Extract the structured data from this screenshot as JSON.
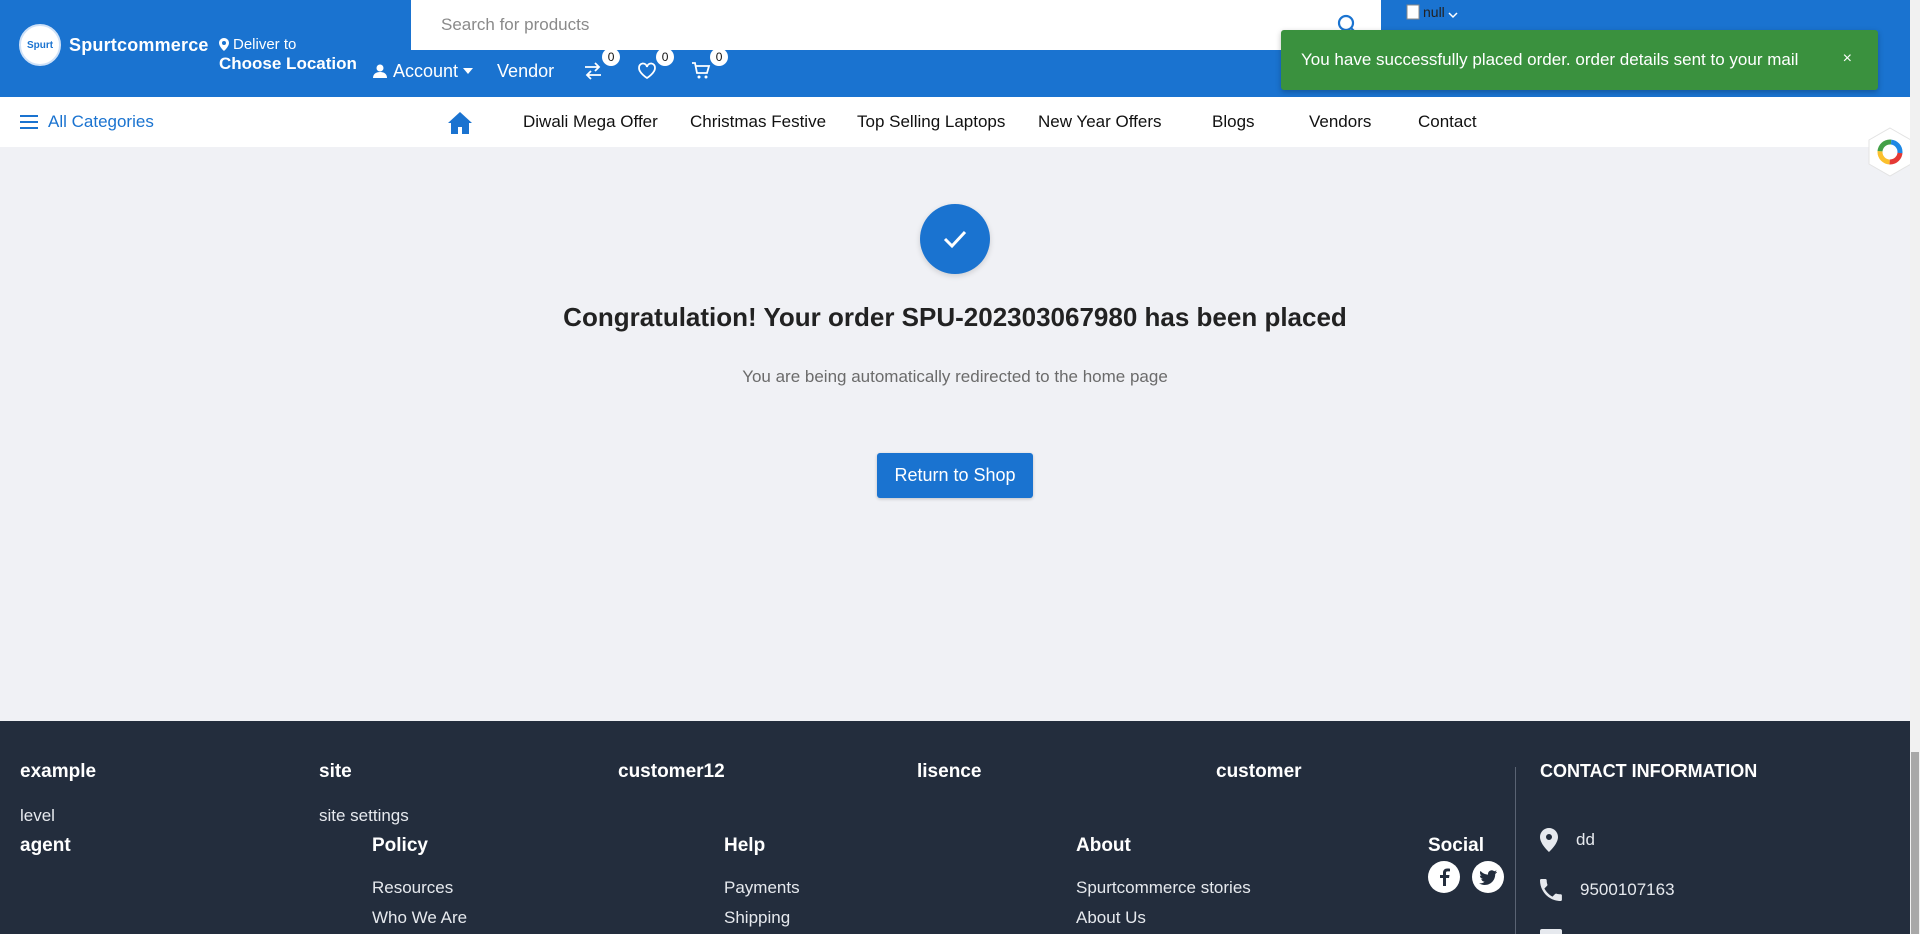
{
  "header": {
    "logo_text": "Spurtcommerce",
    "logo_badge": "Spurt",
    "deliver_label": "Deliver to",
    "location": "Choose Location",
    "search_placeholder": "Search for products",
    "avatar_alt": "null",
    "account_label": "Account",
    "vendor_label": "Vendor",
    "compare_count": "0",
    "wishlist_count": "0",
    "cart_count": "0"
  },
  "toast": {
    "message": "You have successfully placed order. order details sent to your mail",
    "close": "×"
  },
  "category_nav": {
    "all_categories": "All Categories",
    "links": [
      "Diwali Mega Offer",
      "Christmas Festive",
      "Top Selling Laptops",
      "New Year Offers",
      "Blogs",
      "Vendors",
      "Contact"
    ]
  },
  "main": {
    "heading": "Congratulation! Your order SPU-202303067980 has been placed",
    "subtext": "You are being automatically redirected to the home page",
    "button": "Return to Shop"
  },
  "footer": {
    "top_headings": [
      "example",
      "site",
      "customer12",
      "lisence",
      "customer"
    ],
    "level": "level",
    "site_settings": "site settings",
    "agent": "agent",
    "policy": {
      "heading": "Policy",
      "links": [
        "Resources",
        "Who We Are"
      ]
    },
    "help": {
      "heading": "Help",
      "links": [
        "Payments",
        "Shipping"
      ]
    },
    "about": {
      "heading": "About",
      "links": [
        "Spurtcommerce stories",
        "About Us"
      ]
    },
    "social": {
      "heading": "Social",
      "icons": [
        "facebook-icon",
        "twitter-icon"
      ]
    },
    "contact": {
      "heading": "CONTACT INFORMATION",
      "address": "dd",
      "phone": "9500107163"
    }
  },
  "colors": {
    "primary": "#1a73d0",
    "toast": "#3a913e",
    "footer": "#232d3d",
    "page_bg": "#f0f1f5"
  }
}
